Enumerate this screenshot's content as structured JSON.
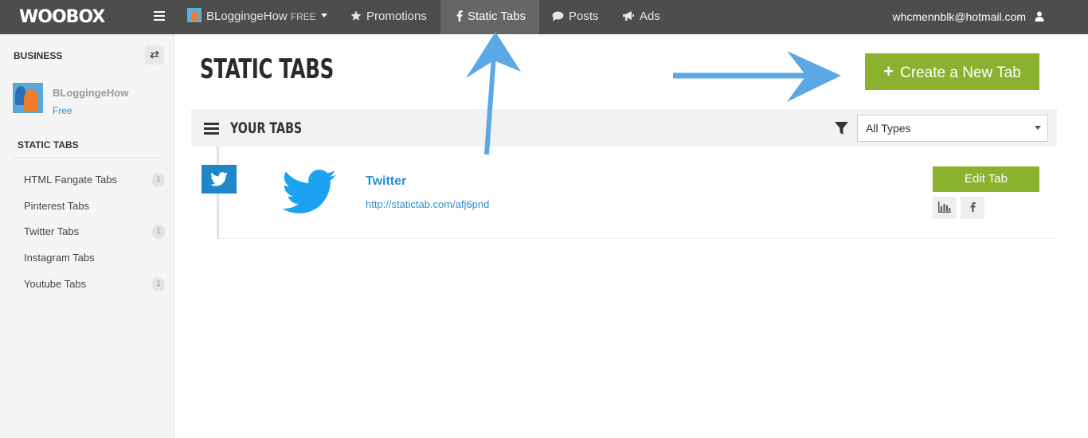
{
  "topnav": {
    "logo": "WOOBOX",
    "account": {
      "name": "BLoggingeHow",
      "plan": "FREE"
    },
    "items": [
      {
        "label": "Promotions",
        "icon": "star-icon"
      },
      {
        "label": "Static Tabs",
        "icon": "facebook-icon",
        "active": true
      },
      {
        "label": "Posts",
        "icon": "speech-bubble-icon"
      },
      {
        "label": "Ads",
        "icon": "megaphone-icon"
      }
    ],
    "email": "whcmennblk@hotmail.com"
  },
  "sidebar": {
    "business_label": "BUSINESS",
    "account_name": "BLoggingeHow",
    "account_plan": "Free",
    "section_title": "STATIC TABS",
    "items": [
      {
        "label": "HTML Fangate Tabs",
        "badge": "1"
      },
      {
        "label": "Pinterest Tabs",
        "badge": ""
      },
      {
        "label": "Twitter Tabs",
        "badge": "1"
      },
      {
        "label": "Instagram Tabs",
        "badge": ""
      },
      {
        "label": "Youtube Tabs",
        "badge": "1"
      }
    ]
  },
  "main": {
    "title": "STATIC TABS",
    "create_label": "Create a New Tab",
    "your_tabs_title": "YOUR TABS",
    "filter_value": "All Types",
    "tabs": [
      {
        "name": "Twitter",
        "url": "http://statictab.com/afj6pnd",
        "edit_label": "Edit Tab"
      }
    ]
  },
  "colors": {
    "accent_green": "#8ab22e",
    "link_blue": "#2a8fd0",
    "nav_bg": "#4d4d4d",
    "twitter_blue": "#1da1f2",
    "arrow_blue": "#5aa8e6"
  }
}
